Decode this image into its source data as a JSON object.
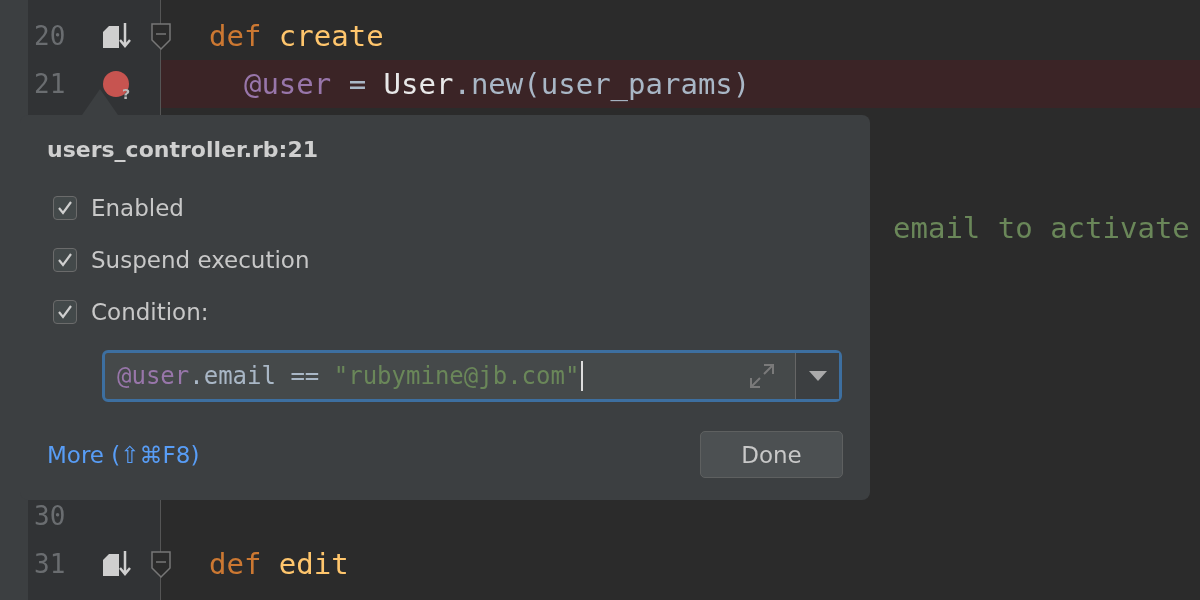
{
  "editor": {
    "lines": [
      {
        "kind": "code",
        "number": "20",
        "marker": {
          "kind": "override"
        },
        "fold": {
          "kind": "collapse"
        },
        "tokens": [
          {
            "text": "def ",
            "kind": "keyword"
          },
          {
            "text": "create",
            "kind": "function"
          }
        ]
      },
      {
        "kind": "code",
        "number": "21",
        "breakpoint": {
          "mark": "?"
        },
        "tokens": [
          {
            "text": "  @user",
            "kind": "ivar"
          },
          {
            "text": " = ",
            "kind": "plain"
          },
          {
            "text": "User",
            "kind": "constant"
          },
          {
            "text": ".new(user_params)",
            "kind": "plain"
          }
        ]
      },
      {
        "kind": "hidden"
      },
      {
        "kind": "hidden"
      },
      {
        "kind": "tail",
        "tokens": [
          {
            "text": "email to activate",
            "kind": "comment"
          }
        ]
      },
      {
        "kind": "hidden"
      },
      {
        "kind": "hidden"
      },
      {
        "kind": "hidden"
      },
      {
        "kind": "hidden"
      },
      {
        "kind": "hidden"
      },
      {
        "kind": "code",
        "number": "30"
      },
      {
        "kind": "code",
        "number": "31",
        "marker": {
          "kind": "override"
        },
        "fold": {
          "kind": "collapse"
        },
        "tokens": [
          {
            "text": "def ",
            "kind": "keyword"
          },
          {
            "text": "edit",
            "kind": "function"
          }
        ]
      }
    ]
  },
  "popup": {
    "title": "users_controller.rb:21",
    "options": [
      {
        "label": "Enabled",
        "checked": true
      },
      {
        "label": "Suspend execution",
        "checked": true
      },
      {
        "label": "Condition:",
        "checked": true
      }
    ],
    "condition": {
      "tokens": [
        {
          "text": "@user",
          "kind": "ivar"
        },
        {
          "text": ".email == ",
          "kind": "plain"
        },
        {
          "text": "\"rubymine@jb.com\"",
          "kind": "string"
        }
      ],
      "focused": true
    },
    "more_link": "More (⇧⌘F8)",
    "done_button": "Done"
  }
}
